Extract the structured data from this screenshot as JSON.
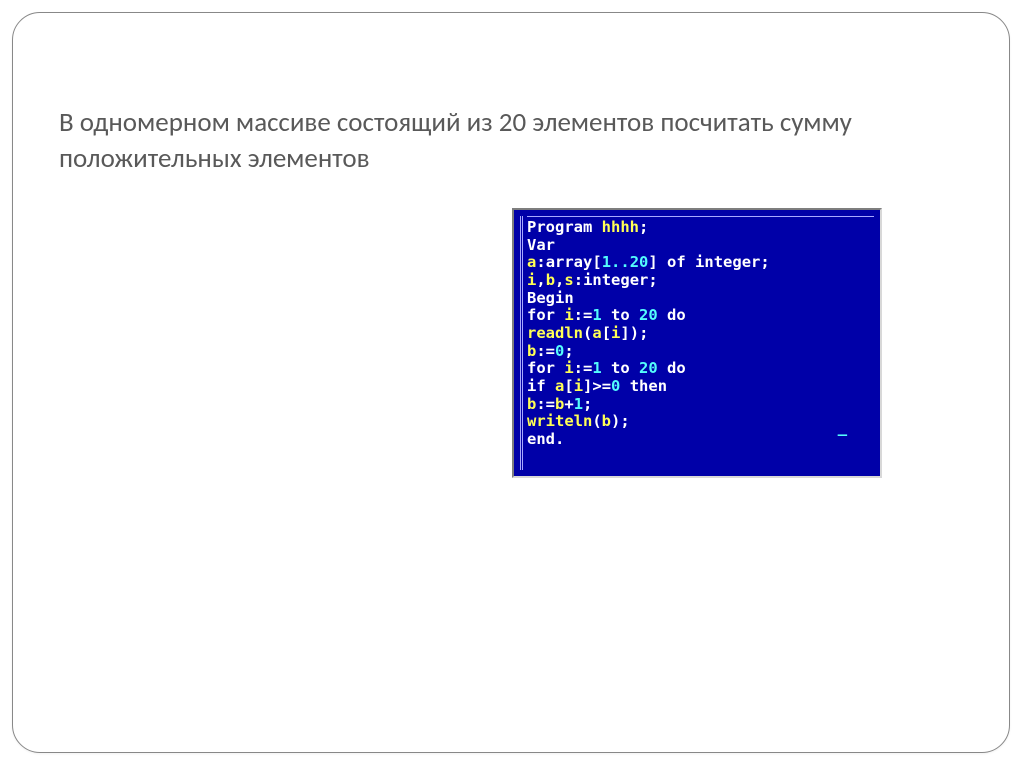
{
  "heading": "В одномерном массиве состоящий из 20 элементов посчитать сумму положительных элементов",
  "code": {
    "l1a": "Program",
    "l1b": " hhhh",
    "l1c": ";",
    "l2a": "Var",
    "l3a": "a",
    "l3b": ":",
    "l3c": "array",
    "l3d": "[",
    "l3e": "1..20",
    "l3f": "]",
    "l3g": " of ",
    "l3h": "integer",
    "l3i": ";",
    "l4a": "i",
    "l4b": ",",
    "l4c": "b",
    "l4d": ",",
    "l4e": "s",
    "l4f": ":",
    "l4g": "integer",
    "l4h": ";",
    "l5a": "Begin",
    "l6a": "for ",
    "l6b": "i",
    "l6c": ":=",
    "l6d": "1",
    "l6e": " to ",
    "l6f": "20",
    "l6g": " do",
    "l7a": "readln",
    "l7b": "(",
    "l7c": "a",
    "l7d": "[",
    "l7e": "i",
    "l7f": "]",
    "l7g": ")",
    "l7h": ";",
    "l8a": "b",
    "l8b": ":=",
    "l8c": "0",
    "l8d": ";",
    "l9a": "for ",
    "l9b": "i",
    "l9c": ":=",
    "l9d": "1",
    "l9e": " to ",
    "l9f": "20",
    "l9g": " do",
    "l10a": "if ",
    "l10b": "a",
    "l10c": "[",
    "l10d": "i",
    "l10e": "]",
    "l10f": ">=",
    "l10g": "0",
    "l10h": " then",
    "l11a": "b",
    "l11b": ":=",
    "l11c": "b",
    "l11d": "+",
    "l11e": "1",
    "l11f": ";",
    "l12a": "writeln",
    "l12b": "(",
    "l12c": "b",
    "l12d": ")",
    "l12e": ";",
    "l13a": "end",
    "l13b": "."
  },
  "cursor": "—"
}
